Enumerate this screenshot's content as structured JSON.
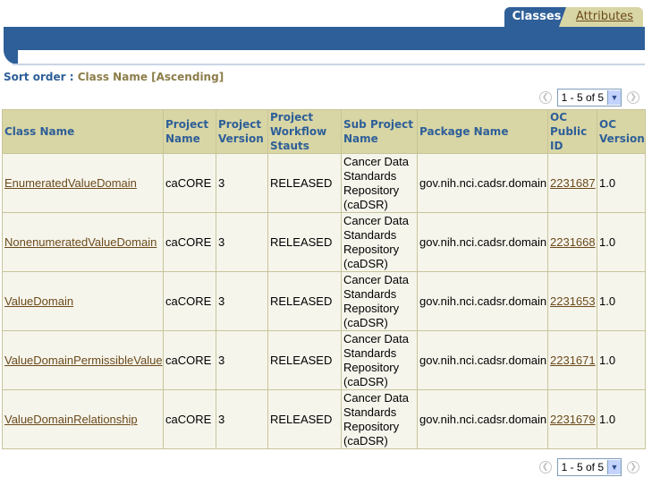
{
  "tabs": [
    {
      "label": "Classes"
    },
    {
      "label": "Attributes"
    }
  ],
  "sort": {
    "label": "Sort order :",
    "value": "Class Name [Ascending]"
  },
  "pager": {
    "selected": "1 - 5 of 5",
    "prev_icon": "circle-chevron-left-icon",
    "next_icon": "circle-chevron-right-icon"
  },
  "table": {
    "headers": [
      "Class Name",
      "Project Name",
      "Project Version",
      "Project Workflow Stauts",
      "Sub Project Name",
      "Package Name",
      "OC Public ID",
      "OC Version"
    ],
    "rows": [
      {
        "class_name": "EnumeratedValueDomain",
        "project_name": "caCORE",
        "project_version": "3",
        "workflow_status": "RELEASED",
        "sub_project": "Cancer Data Standards Repository (caDSR)",
        "package": "gov.nih.nci.cadsr.domain",
        "public_id": "2231687",
        "version": "1.0"
      },
      {
        "class_name": "NonenumeratedValueDomain",
        "project_name": "caCORE",
        "project_version": "3",
        "workflow_status": "RELEASED",
        "sub_project": "Cancer Data Standards Repository (caDSR)",
        "package": "gov.nih.nci.cadsr.domain",
        "public_id": "2231668",
        "version": "1.0"
      },
      {
        "class_name": "ValueDomain",
        "project_name": "caCORE",
        "project_version": "3",
        "workflow_status": "RELEASED",
        "sub_project": "Cancer Data Standards Repository (caDSR)",
        "package": "gov.nih.nci.cadsr.domain",
        "public_id": "2231653",
        "version": "1.0"
      },
      {
        "class_name": "ValueDomainPermissibleValue",
        "project_name": "caCORE",
        "project_version": "3",
        "workflow_status": "RELEASED",
        "sub_project": "Cancer Data Standards Repository (caDSR)",
        "package": "gov.nih.nci.cadsr.domain",
        "public_id": "2231671",
        "version": "1.0"
      },
      {
        "class_name": "ValueDomainRelationship",
        "project_name": "caCORE",
        "project_version": "3",
        "workflow_status": "RELEASED",
        "sub_project": "Cancer Data Standards Repository (caDSR)",
        "package": "gov.nih.nci.cadsr.domain",
        "public_id": "2231679",
        "version": "1.0"
      }
    ]
  },
  "colors": {
    "brand_blue": "#2e5f98",
    "header_bg": "#d9d6a5",
    "cell_bg": "#f6f5ec",
    "link": "#6b4a1b"
  }
}
